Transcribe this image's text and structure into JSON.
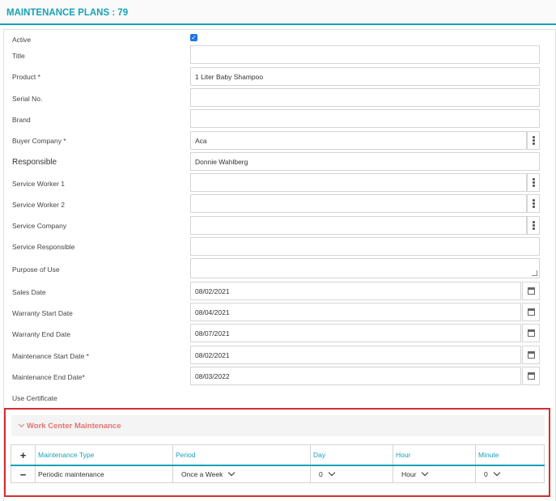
{
  "header": {
    "title": "MAINTENANCE PLANS : 79"
  },
  "form": {
    "active_label": "Active",
    "active_checked": true,
    "title_label": "Title",
    "title_value": "",
    "product_label": "Product *",
    "product_value": "1 Liter Baby Shampoo",
    "serial_label": "Serial No.",
    "serial_value": "",
    "brand_label": "Brand",
    "brand_value": "",
    "buyer_label": "Buyer Company *",
    "buyer_value": "Aca",
    "responsible_label": "Responsible",
    "responsible_value": "Donnie Wahlberg",
    "worker1_label": "Service Worker 1",
    "worker1_value": "",
    "worker2_label": "Service Worker 2",
    "worker2_value": "",
    "service_company_label": "Service Company",
    "service_company_value": "",
    "service_responsible_label": "Service Responsible",
    "service_responsible_value": "",
    "purpose_label": "Purpose of Use",
    "purpose_value": "",
    "sales_date_label": "Sales Date",
    "sales_date_value": "08/02/2021",
    "warranty_start_label": "Warranty Start Date",
    "warranty_start_value": "08/04/2021",
    "warranty_end_label": "Warranty End Date",
    "warranty_end_value": "08/07/2021",
    "maint_start_label": "Maintenance Start Date *",
    "maint_start_value": "08/02/2021",
    "maint_end_label": "Maintenance End Date*",
    "maint_end_value": "08/03/2022",
    "certificate_label": "Use Certificate"
  },
  "work_center": {
    "title": "Work Center Maintenance",
    "add_symbol": "+",
    "columns": [
      "Maintenance Type",
      "Period",
      "Day",
      "Hour",
      "Minute"
    ],
    "row": {
      "remove_symbol": "−",
      "type": "Periodic maintenance",
      "period": "Once a Week",
      "day": "0",
      "hour": "Hour",
      "minute": "0"
    }
  },
  "colors": {
    "accent": "#17a2b8",
    "highlight_border": "#d32f2f",
    "section_title": "#e57373"
  }
}
